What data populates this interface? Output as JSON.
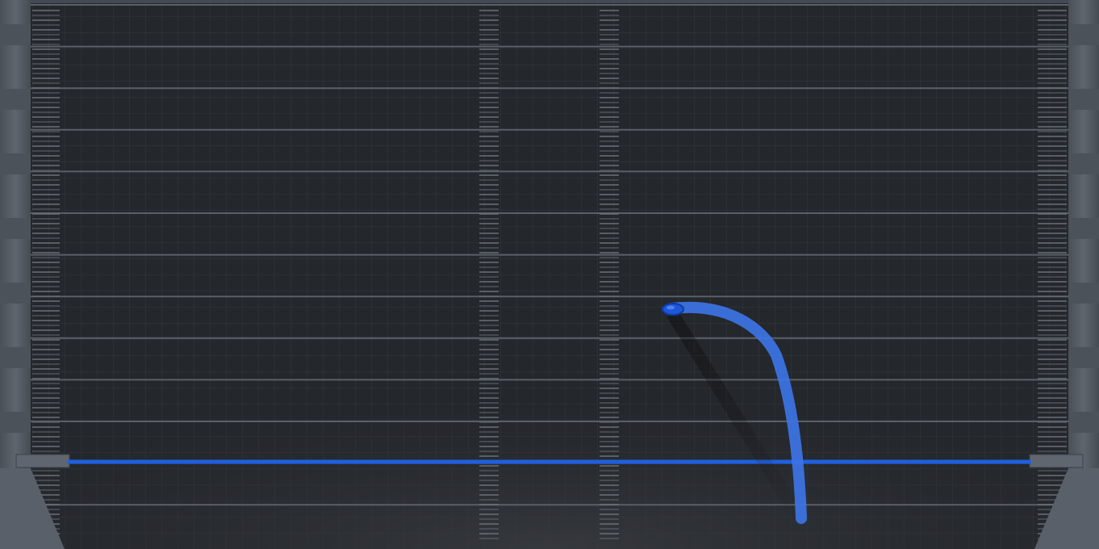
{
  "scene": {
    "name": "level-board",
    "colors": {
      "background": "#24272c",
      "grid_fine": "#3a3e44",
      "shelf_line": "#5a6068",
      "wall": "#545b64",
      "wall_dark": "#3b4148",
      "tick": "#6b7078",
      "launch_line": "#1f5fe0",
      "trajectory": "#3d74e6",
      "ball": "#1e56d8"
    },
    "shelf_count": 13,
    "tick_columns": [
      "left-wall-ticks",
      "center-left-ticks",
      "center-right-ticks",
      "right-wall-ticks"
    ],
    "elements": {
      "launch_line": "blue-launch-line",
      "trajectory": "trajectory-path",
      "ball": "ball",
      "left_bracket": "left-rail-bracket",
      "right_bracket": "right-rail-bracket"
    }
  }
}
